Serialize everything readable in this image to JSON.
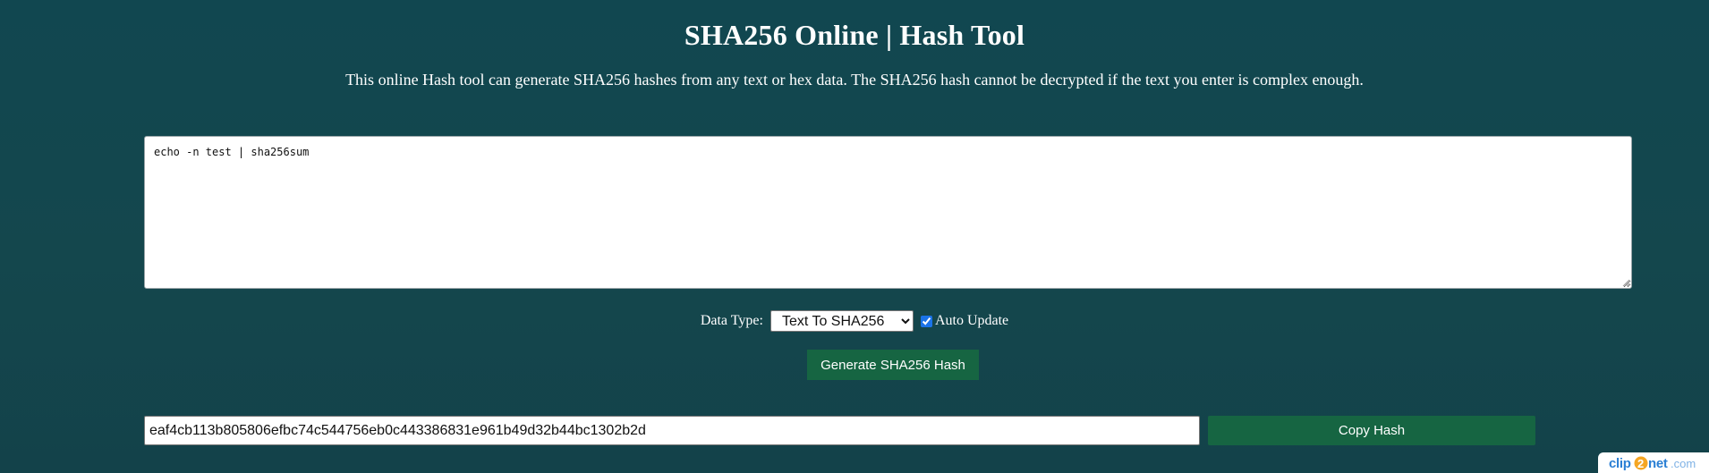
{
  "header": {
    "title": "SHA256 Online | Hash Tool",
    "subtitle": "This online Hash tool can generate SHA256 hashes from any text or hex data. The SHA256 hash cannot be decrypted if the text you enter is complex enough."
  },
  "input": {
    "value": "echo -n test | sha256sum"
  },
  "controls": {
    "data_type_label": "Data Type:",
    "data_type_selected": "Text To SHA256",
    "auto_update_label": "Auto Update",
    "auto_update_checked": true,
    "generate_label": "Generate SHA256 Hash"
  },
  "output": {
    "hash_value": "eaf4cb113b805806efbc74c544756eb0c443386831e961b49d32b44bc1302b2d",
    "copy_label": "Copy Hash"
  },
  "watermark": {
    "text": "clip2net.com"
  },
  "colors": {
    "background": "#13464d",
    "button": "#166542",
    "watermark_blue": "#2a7fd4",
    "watermark_orange": "#f5a623"
  },
  "icons": {
    "checkbox": "checkmark-icon",
    "select_arrow": "chevron-down-icon",
    "resize": "resize-grip-icon"
  }
}
